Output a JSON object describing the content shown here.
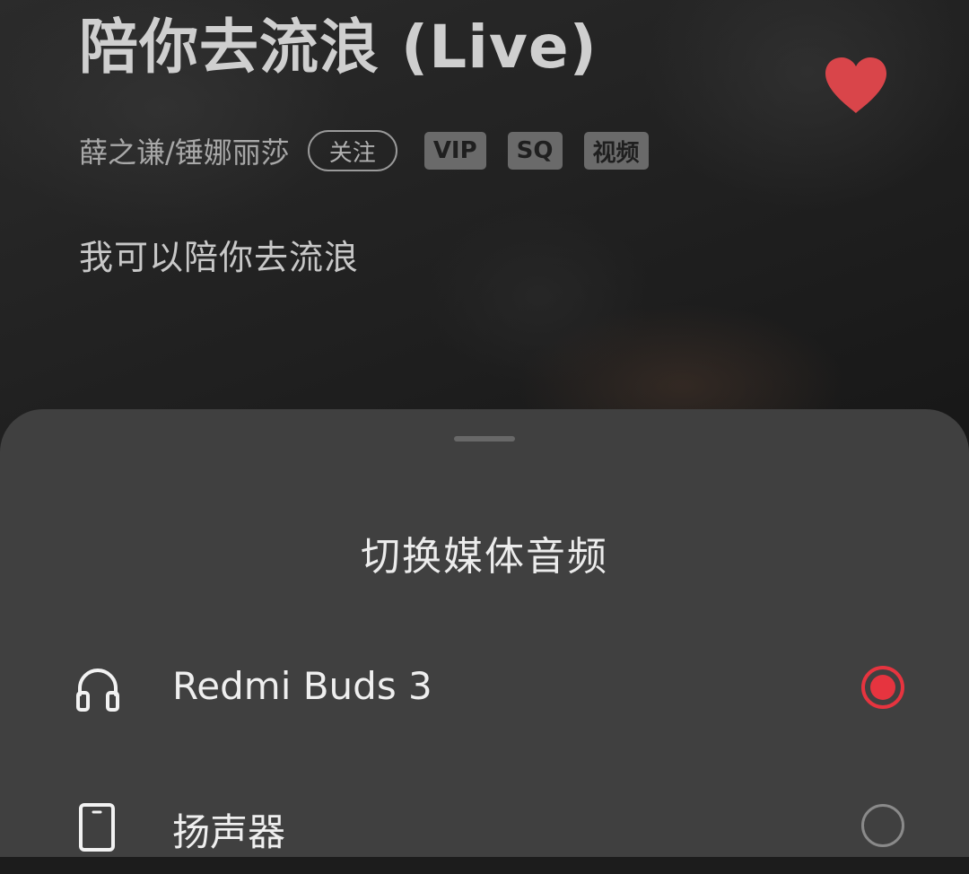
{
  "song": {
    "title": "陪你去流浪 (Live)",
    "artist": "薛之谦/锤娜丽莎",
    "follow_label": "关注",
    "tags": [
      "VIP",
      "SQ",
      "视频"
    ],
    "lyric": "我可以陪你去流浪",
    "liked": true,
    "heart_color": "#d9454a"
  },
  "sheet": {
    "title": "切换媒体音频",
    "options": [
      {
        "label": "Redmi Buds 3",
        "icon": "headphones-icon",
        "selected": true
      },
      {
        "label": "扬声器",
        "icon": "phone-icon",
        "selected": false
      }
    ]
  },
  "colors": {
    "accent": "#e6343f",
    "sheet_bg": "#404040"
  }
}
